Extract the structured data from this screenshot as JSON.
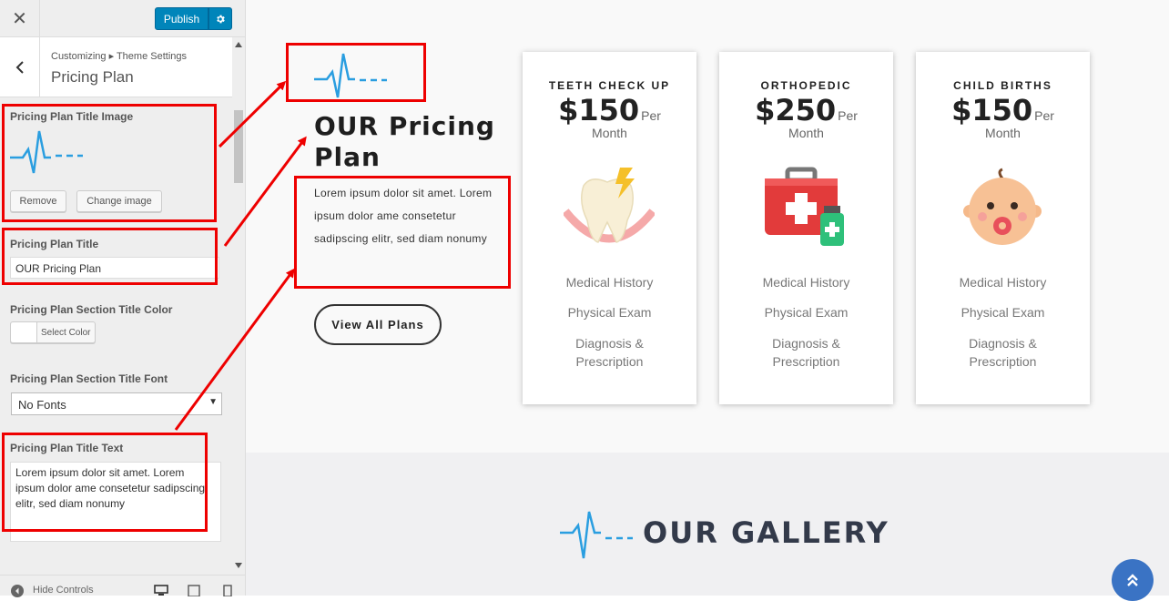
{
  "topbar": {
    "close_icon": "close-icon",
    "publish_label": "Publish",
    "settings_icon": "gear-icon"
  },
  "section": {
    "breadcrumb": "Customizing ▸ Theme Settings",
    "title": "Pricing Plan"
  },
  "controls": {
    "title_image": {
      "label": "Pricing Plan Title Image",
      "remove_label": "Remove",
      "change_label": "Change image"
    },
    "title": {
      "label": "Pricing Plan Title",
      "value": "OUR Pricing Plan"
    },
    "title_color": {
      "label": "Pricing Plan Section Title Color",
      "button_label": "Select Color"
    },
    "title_font": {
      "label": "Pricing Plan Section Title Font",
      "value": "No Fonts"
    },
    "title_text": {
      "label": "Pricing Plan Title Text",
      "value": "Lorem ipsum dolor sit amet. Lorem ipsum dolor ame consetetur sadipscing elitr, sed diam nonumy"
    }
  },
  "footer": {
    "hide_label": "Hide Controls"
  },
  "preview": {
    "heading": "OUR Pricing Plan",
    "paragraph": "Lorem ipsum dolor sit amet. Lorem ipsum dolor ame consetetur sadipscing elitr, sed diam nonumy",
    "view_all": "View All Plans",
    "plans": [
      {
        "title": "TEETH CHECK UP",
        "price": "$150",
        "per": "Per",
        "period": "Month",
        "icon": "tooth-icon",
        "features": [
          "Medical History",
          "Physical Exam",
          "Diagnosis &",
          "Prescription"
        ]
      },
      {
        "title": "ORTHOPEDIC",
        "price": "$250",
        "per": "Per",
        "period": "Month",
        "icon": "first-aid-kit-icon",
        "features": [
          "Medical History",
          "Physical Exam",
          "Diagnosis &",
          "Prescription"
        ]
      },
      {
        "title": "CHILD BIRTHS",
        "price": "$150",
        "per": "Per",
        "period": "Month",
        "icon": "baby-icon",
        "features": [
          "Medical History",
          "Physical Exam",
          "Diagnosis &",
          "Prescription"
        ]
      }
    ],
    "gallery_title": "OUR GALLERY"
  },
  "colors": {
    "publish": "#0085ba",
    "annotation": "#ee0000",
    "heartbeat": "#2a9ee0",
    "gallery_text": "#333a4a",
    "back_to_top": "#3a73c4"
  }
}
